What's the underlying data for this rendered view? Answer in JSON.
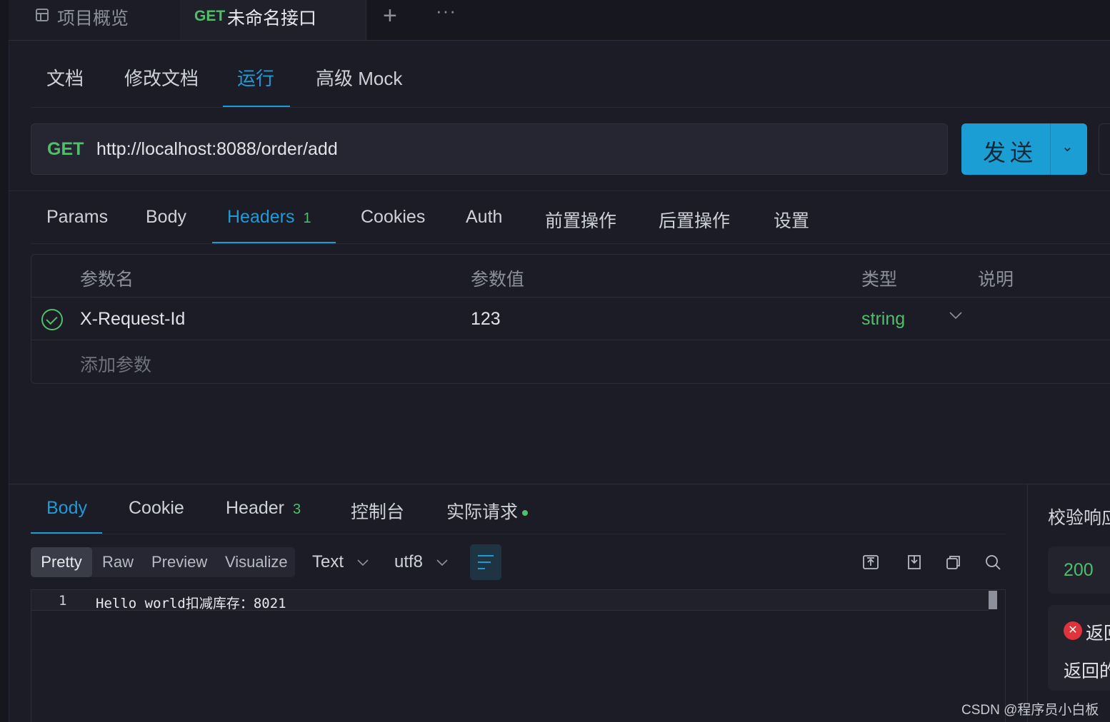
{
  "tabs": {
    "overview_label": "项目概览",
    "api_method": "GET",
    "api_name": "未命名接口",
    "add": "+",
    "more": "···"
  },
  "subtabs": [
    "文档",
    "修改文档",
    "运行",
    "高级 Mock"
  ],
  "request": {
    "method": "GET",
    "url": "http://localhost:8088/order/add",
    "send_label": "发送",
    "dropdown_icon": "⌄"
  },
  "request_tabs": {
    "params": "Params",
    "body": "Body",
    "headers": "Headers",
    "headers_count": "1",
    "cookies": "Cookies",
    "auth": "Auth",
    "pre": "前置操作",
    "post": "后置操作",
    "settings": "设置"
  },
  "headers_table": {
    "columns": [
      "参数名",
      "参数值",
      "类型",
      "说明"
    ],
    "rows": [
      {
        "name": "X-Request-Id",
        "value": "123",
        "type": "string"
      }
    ],
    "add_placeholder": "添加参数"
  },
  "response_tabs": {
    "body": "Body",
    "cookie": "Cookie",
    "header": "Header",
    "header_count": "3",
    "console": "控制台",
    "actual": "实际请求"
  },
  "view_modes": [
    "Pretty",
    "Raw",
    "Preview",
    "Visualize"
  ],
  "format": {
    "type": "Text",
    "encoding": "utf8"
  },
  "editor": {
    "line_number": "1",
    "content": "Hello world扣减库存：8021"
  },
  "validation": {
    "title": "校验响应",
    "status_code": "200",
    "error_title": "返回",
    "error_desc": "返回的"
  },
  "watermark": "CSDN @程序员小白板",
  "colors": {
    "accent": "#1d9bd8",
    "success": "#4fbf6c",
    "error": "#e0333b",
    "background": "#1b1c25"
  }
}
